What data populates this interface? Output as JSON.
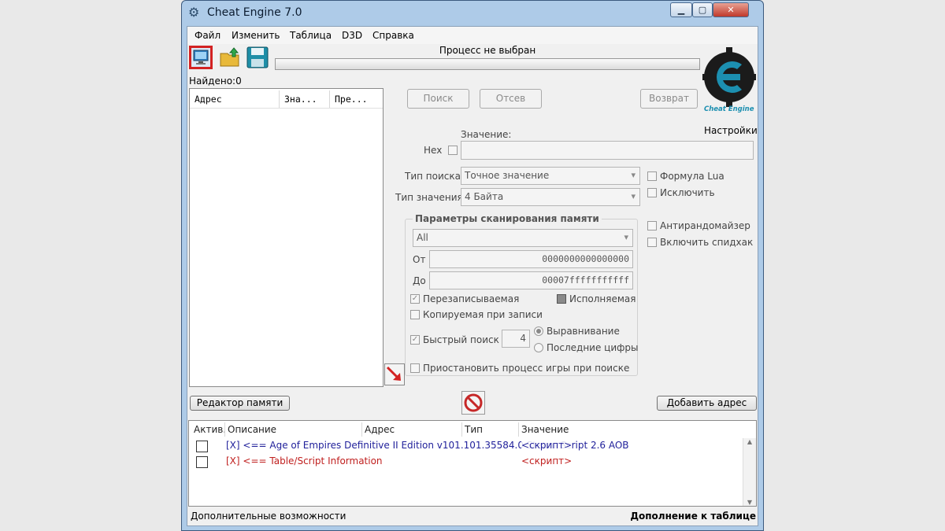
{
  "window": {
    "title": "Cheat Engine 7.0"
  },
  "menu": [
    "Файл",
    "Изменить",
    "Таблица",
    "D3D",
    "Справка"
  ],
  "toolbar": {
    "process_label": "Процесс не выбран",
    "progress_value": 0
  },
  "found_label": "Найдено:0",
  "logo": {
    "caption": "Cheat Engine",
    "settings_label": "Настройки"
  },
  "results_list": {
    "columns": [
      "Адрес",
      "Зна...",
      "Пре..."
    ]
  },
  "scan_buttons": {
    "first": "Поиск",
    "next": "Отсев",
    "undo": "Возврат"
  },
  "value": {
    "label": "Значение:",
    "hex_label": "Hex",
    "input": ""
  },
  "scan_type": {
    "label": "Тип поиска",
    "selected": "Точное значение"
  },
  "value_type": {
    "label": "Тип значения",
    "selected": "4 Байта"
  },
  "options_right": {
    "lua_formula": "Формула Lua",
    "not": "Исключить",
    "unrandomizer": "Антирандомайзер",
    "speedhack": "Включить спидхак"
  },
  "memory_scan": {
    "title": "Параметры сканирования памяти",
    "region": "All",
    "from_label": "От",
    "from_value": "0000000000000000",
    "to_label": "До",
    "to_value": "00007fffffffffff",
    "writable": "Перезаписываемая",
    "executable": "Исполняемая",
    "copy_on_write": "Копируемая при записи",
    "fast_scan": "Быстрый поиск",
    "fast_scan_value": "4",
    "alignment": "Выравнивание",
    "last_digits": "Последние цифры",
    "pause": "Приостановить процесс игры при поиске"
  },
  "buttons": {
    "memory_view": "Редактор памяти",
    "add_address": "Добавить адрес"
  },
  "cheat_table": {
    "columns": [
      "Актив.",
      "Описание",
      "Адрес",
      "Тип",
      "Значение"
    ],
    "rows": [
      {
        "description": "[X] <== Age of Empires Definitive II Edition v101.101.35584.0 Steam Script 2.6 AOB",
        "value": "<скрипт>",
        "color": "#1f1f9a"
      },
      {
        "description": "[X] <== Table/Script Information",
        "value": "<скрипт>",
        "color": "#c0201f"
      }
    ]
  },
  "statusbar": {
    "left": "Дополнительные возможности",
    "right": "Дополнение к таблице"
  },
  "colors": {
    "accent_red": "#d32222",
    "link_blue": "#1f1f9a",
    "script_red": "#c0201f"
  }
}
